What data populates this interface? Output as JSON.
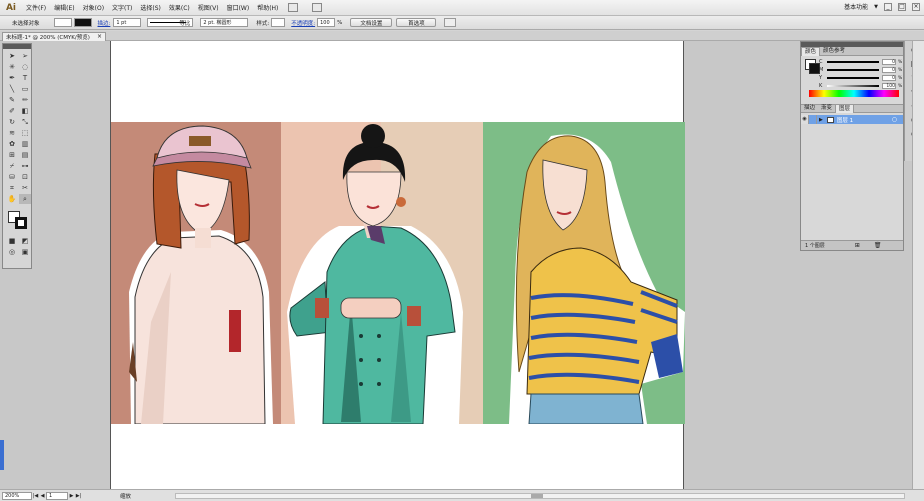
{
  "menubar": {
    "logo": "Ai",
    "items": [
      "文件(F)",
      "编辑(E)",
      "对象(O)",
      "文字(T)",
      "选择(S)",
      "效果(C)",
      "视图(V)",
      "窗口(W)",
      "帮助(H)"
    ],
    "workspace": "基本功能",
    "win_min": "_",
    "win_max": "□",
    "win_close": "×"
  },
  "controlbar": {
    "selection": "未选择对象",
    "stroke_label": "描边:",
    "stroke_value": "1 pt",
    "uniform": "等比",
    "brush": "2 pt. 椭圆形",
    "style_label": "样式:",
    "opacity_label": "不透明度:",
    "opacity_value": "100",
    "opacity_unit": "%",
    "doc_setup": "文档设置",
    "preferences": "首选项"
  },
  "doc_tab": {
    "title": "未标题-1* @ 200% (CMYK/预览)",
    "close": "×"
  },
  "color_panel": {
    "tab_color": "颜色",
    "tab_color_ref": "颜色参考",
    "sliders": [
      {
        "letter": "C",
        "value": "0",
        "unit": "%"
      },
      {
        "letter": "M",
        "value": "0",
        "unit": "%"
      },
      {
        "letter": "Y",
        "value": "0",
        "unit": "%"
      },
      {
        "letter": "K",
        "value": "100",
        "unit": "%"
      }
    ]
  },
  "layers_panel": {
    "tabs": [
      "描边",
      "渐变",
      "图层"
    ],
    "active_tab": "图层",
    "layer_name": "图层 1",
    "footer": "1 个图层"
  },
  "status": {
    "zoom": "200%",
    "page": "1",
    "mode": "缩放"
  },
  "colors": {
    "panel_bg": "#d6d6d6",
    "art_brown": "#c48a78",
    "art_pink": "#ecc4b0",
    "art_green": "#7dbd87",
    "layer_highlight": "#6fa1e6"
  }
}
